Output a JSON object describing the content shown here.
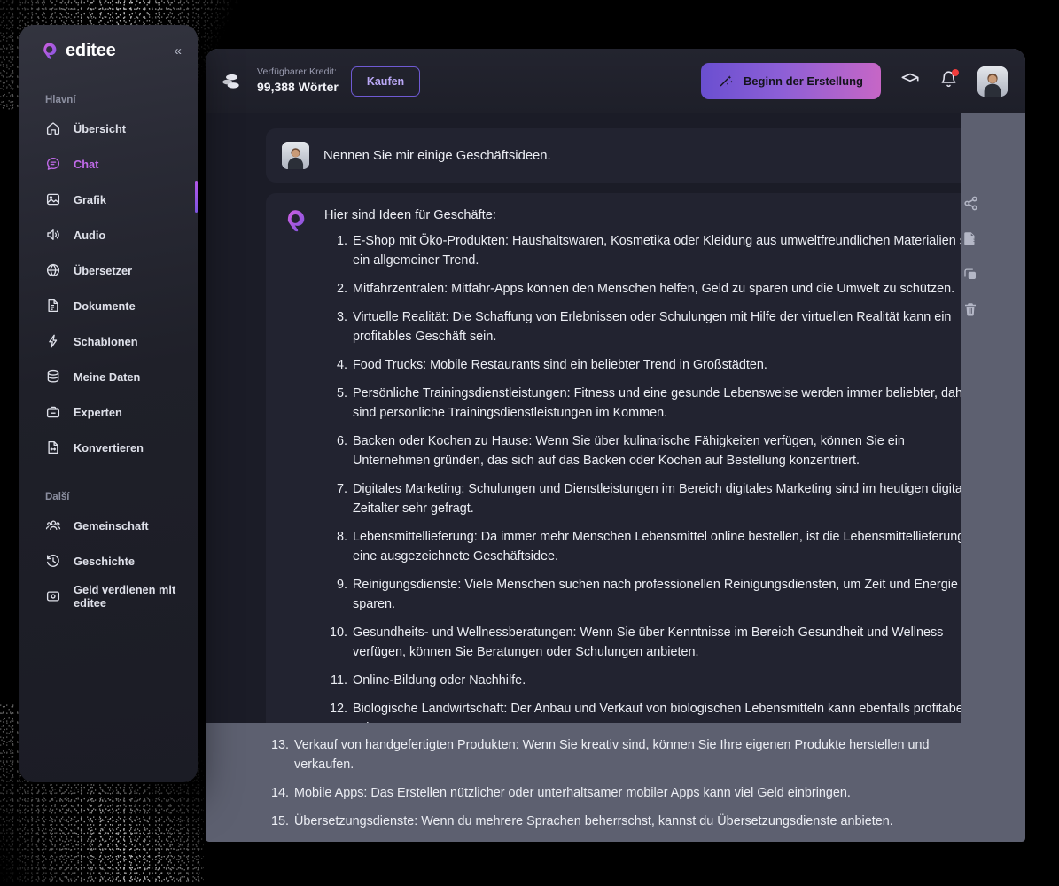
{
  "sidebar": {
    "logo_text": "editee",
    "collapse_icon": "chevrons-left-icon",
    "sections": [
      {
        "title": "Hlavní",
        "items": [
          {
            "label": "Übersicht",
            "icon": "home-icon",
            "active": false
          },
          {
            "label": "Chat",
            "icon": "chat-icon",
            "active": true
          },
          {
            "label": "Grafik",
            "icon": "image-icon",
            "active": false
          },
          {
            "label": "Audio",
            "icon": "speaker-icon",
            "active": false
          },
          {
            "label": "Übersetzer",
            "icon": "globe-icon",
            "active": false
          },
          {
            "label": "Dokumente",
            "icon": "document-icon",
            "active": false
          },
          {
            "label": "Schablonen",
            "icon": "bolt-icon",
            "active": false
          },
          {
            "label": "Meine Daten",
            "icon": "database-icon",
            "active": false
          },
          {
            "label": "Experten",
            "icon": "toolbox-icon",
            "active": false
          },
          {
            "label": "Konvertieren",
            "icon": "file-convert-icon",
            "active": false
          }
        ]
      },
      {
        "title": "Další",
        "items": [
          {
            "label": "Gemeinschaft",
            "icon": "users-icon",
            "active": false
          },
          {
            "label": "Geschichte",
            "icon": "history-icon",
            "active": false
          },
          {
            "label": "Geld verdienen mit editee",
            "icon": "money-box-icon",
            "active": false
          }
        ]
      }
    ]
  },
  "header": {
    "coin_icon": "coins-icon",
    "credit_label": "Verfügbarer Kredit:",
    "credit_value": "99,388 Wörter",
    "buy_label": "Kaufen",
    "create_label": "Beginn der Erstellung",
    "create_icon": "magic-wand-icon",
    "academy_icon": "graduation-cap-icon",
    "notification_icon": "bell-icon",
    "avatar_icon": "user-avatar"
  },
  "rail": {
    "items": [
      {
        "icon": "share-icon",
        "name": "share-button"
      },
      {
        "icon": "file-export-icon",
        "name": "export-button"
      },
      {
        "icon": "copy-icon",
        "name": "copy-button"
      },
      {
        "icon": "trash-icon",
        "name": "delete-button"
      }
    ]
  },
  "chat": {
    "user_message": "Nennen Sie mir einige Geschäftsideen.",
    "bot_intro": "Hier sind Ideen für Geschäfte:",
    "ideas": [
      "E-Shop mit Öko-Produkten: Haushaltswaren, Kosmetika oder Kleidung aus umweltfreundlichen Materialien sind ein allgemeiner Trend.",
      "Mitfahrzentralen: Mitfahr-Apps können den Menschen helfen, Geld zu sparen und die Umwelt zu schützen.",
      "Virtuelle Realität: Die Schaffung von Erlebnissen oder Schulungen mit Hilfe der virtuellen Realität kann ein profitables Geschäft sein.",
      "Food Trucks: Mobile Restaurants sind ein beliebter Trend in Großstädten.",
      "Persönliche Trainingsdienstleistungen: Fitness und eine gesunde Lebensweise werden immer beliebter, daher sind persönliche Trainingsdienstleistungen im Kommen.",
      "Backen oder Kochen zu Hause: Wenn Sie über kulinarische Fähigkeiten verfügen, können Sie ein Unternehmen gründen, das sich auf das Backen oder Kochen auf Bestellung konzentriert.",
      "Digitales Marketing: Schulungen und Dienstleistungen im Bereich digitales Marketing sind im heutigen digitalen Zeitalter sehr gefragt.",
      "Lebensmittellieferung: Da immer mehr Menschen Lebensmittel online bestellen, ist die Lebensmittellieferung eine ausgezeichnete Geschäftsidee.",
      "Reinigungsdienste: Viele Menschen suchen nach professionellen Reinigungsdiensten, um Zeit und Energie zu sparen.",
      "Gesundheits- und Wellnessberatungen: Wenn Sie über Kenntnisse im Bereich Gesundheit und Wellness verfügen, können Sie Beratungen oder Schulungen anbieten.",
      "Online-Bildung oder Nachhilfe.",
      "Biologische Landwirtschaft: Der Anbau und Verkauf von biologischen Lebensmitteln kann ebenfalls profitabel sein.",
      "Verkauf von handgefertigten Produkten: Wenn Sie kreativ sind, können Sie Ihre eigenen Produkte herstellen und verkaufen.",
      "Mobile Apps: Das Erstellen nützlicher oder unterhaltsamer mobiler Apps kann viel Geld einbringen.",
      "Übersetzungsdienste: Wenn du mehrere Sprachen beherrschst, kannst du Übersetzungsdienste anbieten."
    ]
  },
  "colors": {
    "accent_purple": "#b457ea",
    "accent_violet": "#7d54e0",
    "gradient_start": "#6a4fd0",
    "gradient_end": "#c666c6",
    "notification_red": "#f03d3d",
    "page_background": "#1b1c27",
    "card_background": "#222330",
    "light_layer": "#5d6070"
  }
}
